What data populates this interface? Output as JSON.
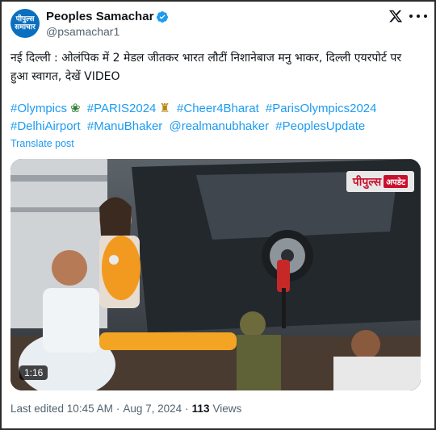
{
  "account": {
    "avatar_line1": "पीपुल्स",
    "avatar_line2": "समाचार",
    "display_name": "Peoples Samachar",
    "handle": "@psamachar1"
  },
  "tweet": {
    "text": "नई दिल्ली : ओलंपिक में 2 मेडल जीतकर भारत लौटीं निशानेबाज मनु भाकर, दिल्ली एयरपोर्ट पर हुआ स्वागत, देखें VIDEO",
    "hashtags": [
      "#Olympics",
      "#PARIS2024",
      "#Cheer4Bharat",
      "#ParisOlympics2024",
      "#DelhiAirport",
      "#ManuBhaker",
      "@realmanubhaker",
      "#PeoplesUpdate"
    ],
    "emoji_after_olympics": "wreath",
    "emoji_after_paris": "eiffel-tower",
    "translate_label": "Translate post"
  },
  "media": {
    "badge_main": "पीपुल्स",
    "badge_sub": "अपडेट",
    "duration": "1:16"
  },
  "footer": {
    "edited": "Last edited 10:45 AM",
    "date": "Aug 7, 2024",
    "views_count": "113",
    "views_label": "Views"
  },
  "colors": {
    "link": "#1d9bf0",
    "verified": "#1d9bf0",
    "muted": "#536471",
    "badge_red": "#c8102e"
  }
}
